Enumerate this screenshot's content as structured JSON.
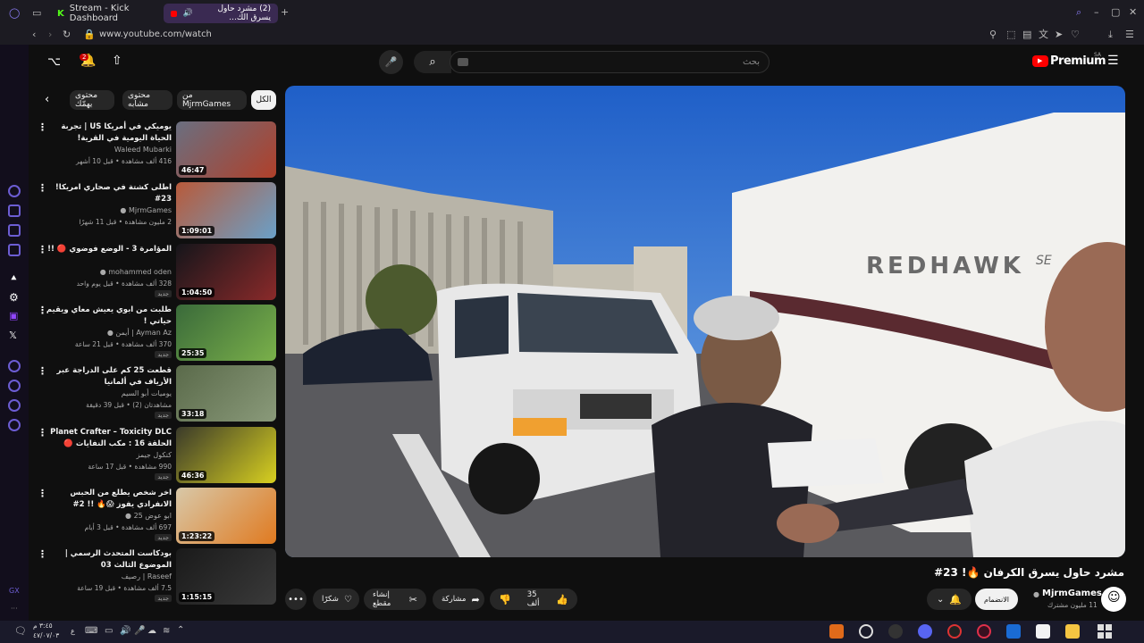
{
  "browser": {
    "tabs": [
      {
        "label": "Stream - Kick Dashboard"
      },
      {
        "label": "(2) مشرد حاول يسرق الك..."
      }
    ],
    "url": "www.youtube.com/watch"
  },
  "header": {
    "brand": "Premium",
    "brand_region": "SA",
    "search_placeholder": "بحث",
    "notification_count": "2"
  },
  "chips": [
    {
      "label": "الكل"
    },
    {
      "label": "من MjrmGames"
    },
    {
      "label": "محتوى مشابه"
    },
    {
      "label": "محتوى يهمّك"
    }
  ],
  "recommendations": [
    {
      "title": "يوميكي في أمريكا US | تجربة الحياة اليومية في القرية!",
      "channel": "Waleed Mubarki",
      "meta": "416 ألف مشاهدة • قبل 10 أشهر",
      "duration": "46:47",
      "badge": "",
      "verified": false
    },
    {
      "title": "اطلى كشتة في صحاري امريكا! 23#",
      "channel": "MjrmGames",
      "meta": "2 مليون مشاهدة • قبل 11 شهرًا",
      "duration": "1:09:01",
      "badge": "",
      "verified": true
    },
    {
      "title": "المؤامرة 3 - الوضع فوضوي 🔴 !!",
      "channel": "mohammed oden",
      "meta": "328 ألف مشاهدة • قبل يوم واحد",
      "duration": "1:04:50",
      "badge": "جديد",
      "verified": true
    },
    {
      "title": "طلبت من ابوي يعيش معاي ويقيم حياتي !",
      "channel": "Ayman Az | أيمن",
      "meta": "370 ألف مشاهدة • قبل 21 ساعة",
      "duration": "25:35",
      "badge": "جديد",
      "verified": true
    },
    {
      "title": "قطعت 25 كم على الدراجة عبر الأرياف في ألمانيا",
      "channel": "يوميات أبو السيم",
      "meta": "مشاهدتان (2) • قبل 39 دقيقة",
      "duration": "33:18",
      "badge": "جديد",
      "verified": false
    },
    {
      "title": "Planet Crafter – Toxicity DLC الحلقة 16 : مكب النفايات 🔴",
      "channel": "كنكول جيمز",
      "meta": "990 مشاهدة • قبل 17 ساعة",
      "duration": "46:36",
      "badge": "جديد",
      "verified": false
    },
    {
      "title": "اخر شخص يطلع من الحبس الانفرادي يفوز 😱🔥 !! 2#",
      "channel": "ابو عوض 25",
      "meta": "697 ألف مشاهدة • قبل 3 أيام",
      "duration": "1:23:22",
      "badge": "جديد",
      "verified": true
    },
    {
      "title": "بودكاست المتحدث الرسمي | الموضوع الثالث 03",
      "channel": "Raseef | رصيف",
      "meta": "7.5 ألف مشاهدة • قبل 19 ساعة",
      "duration": "1:15:15",
      "badge": "جديد",
      "verified": false
    }
  ],
  "video": {
    "title": "مشرد حاول يسرق الكرفان 🔥! 23#",
    "rv_brand": "REDHAWK",
    "rv_brand_suffix": "SE",
    "channel": "MjrmGames",
    "subscribers": "11 مليون مشترك",
    "subscribe_label": "الانضمام",
    "likes": "35 ألف",
    "share_label": "مشاركة",
    "clip_label": "إنشاء مقطع",
    "thanks_label": "شكرًا"
  },
  "taskbar": {
    "time": "٣:٤٥ م",
    "date": "٤٧/٠٧/٠٣",
    "lang": "ع"
  },
  "colors": {
    "yt_red": "#ff0000",
    "accent": "#6c5dd3"
  }
}
